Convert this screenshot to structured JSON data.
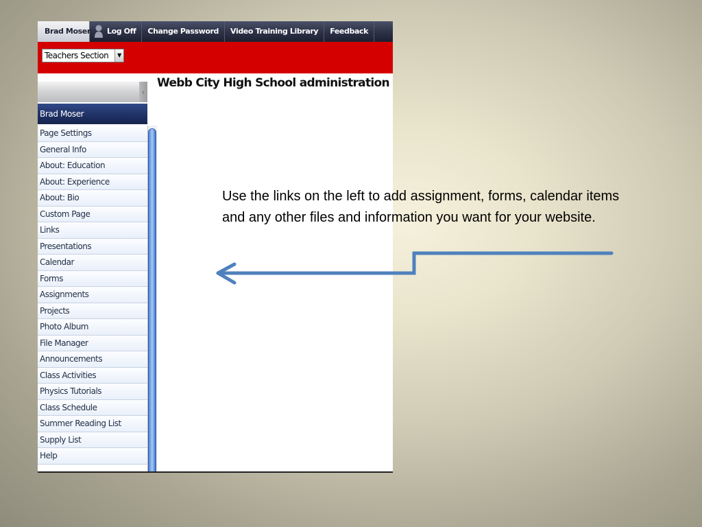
{
  "topnav": {
    "user": "Brad Moser",
    "log_off": "Log Off",
    "change_password": "Change Password",
    "video_training": "Video Training Library",
    "feedback": "Feedback"
  },
  "section_select": {
    "value": "Teachers Section"
  },
  "sidebar": {
    "header": "Brad Moser",
    "items": [
      "Page Settings",
      "General Info",
      "About: Education",
      "About: Experience",
      "About: Bio",
      "Custom Page",
      "Links",
      "Presentations",
      "Calendar",
      "Forms",
      "Assignments",
      "Projects",
      "Photo Album",
      "File Manager",
      "Announcements",
      "Class Activities",
      "Physics Tutorials",
      "Class Schedule",
      "Summer Reading List",
      "Supply List",
      "Help"
    ]
  },
  "main": {
    "title": "Webb City High School administration area"
  },
  "annotation": {
    "text": "Use the links on the left to add assignment, forms, calendar items and any other files and information you want for your website.",
    "arrow_color": "#4f81bd"
  },
  "colors": {
    "nav_dark": "#2e3348",
    "red_bar": "#d40000",
    "sidebar_header": "#1e3063",
    "scroll_thumb": "#4f85d8"
  },
  "icons": {
    "logoff": "person-icon",
    "select_arrow": "chevron-down-icon",
    "collapse": "chevron-left-icon"
  }
}
